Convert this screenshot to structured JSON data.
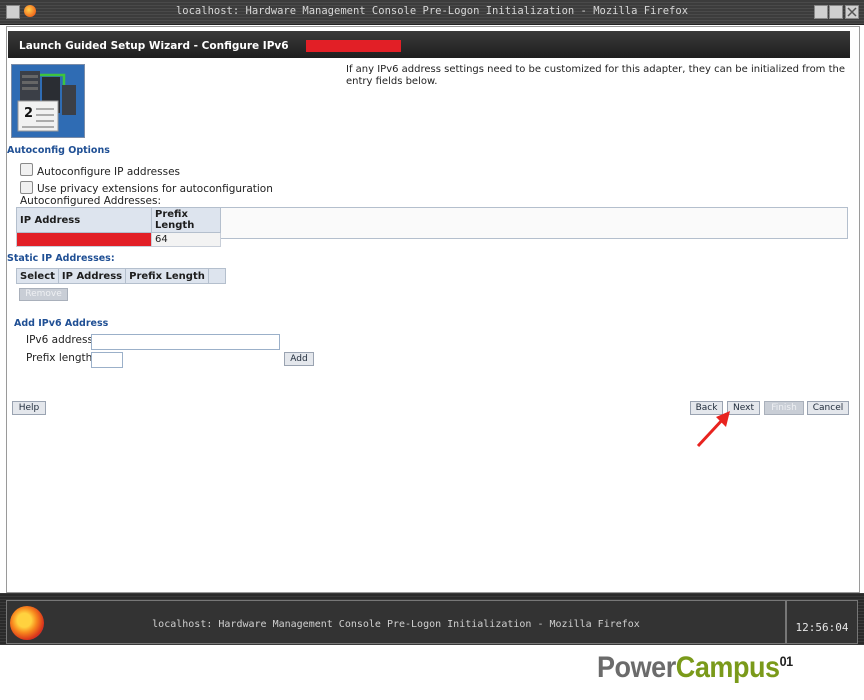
{
  "window": {
    "title": "localhost: Hardware Management Console Pre-Logon Initialization - Mozilla Firefox"
  },
  "header": {
    "title": "Launch Guided Setup Wizard - Configure IPv6"
  },
  "intro_text": "If any IPv6 address settings need to be customized for this adapter, they can be initialized from the entry fields below.",
  "wizard_icon": {
    "step": "2"
  },
  "autoconfig": {
    "heading": "Autoconfig Options",
    "option1": "Autoconfigure IP addresses",
    "option1_checked": false,
    "option2": "Use privacy extensions for autoconfiguration",
    "option2_checked": false,
    "addresses_label": "Autoconfigured Addresses:",
    "columns": [
      "IP Address",
      "Prefix Length"
    ],
    "rows": [
      {
        "ip": "",
        "prefix": "64"
      }
    ]
  },
  "static": {
    "heading": "Static IP Addresses:",
    "columns": [
      "Select",
      "IP Address",
      "Prefix Length"
    ],
    "remove_label": "Remove"
  },
  "add": {
    "heading": "Add IPv6 Address",
    "ipv6_label": "IPv6 address:",
    "ipv6_value": "",
    "prefix_label": "Prefix length:",
    "prefix_value": "",
    "add_label": "Add"
  },
  "buttons": {
    "help": "Help",
    "back": "Back",
    "next": "Next",
    "finish": "Finish",
    "cancel": "Cancel"
  },
  "taskbar": {
    "item_title": "localhost: Hardware Management Console Pre-Logon Initialization - Mozilla Firefox",
    "clock": "12:56:04"
  },
  "watermark": {
    "part1": "Power",
    "part2": "Campus",
    "suffix": "01",
    "color1": "#6b6b6b",
    "color2": "#7a9a1a"
  },
  "colors": {
    "redaction": "#e21f26",
    "section_heading": "#1f4f94",
    "annotation_arrow": "#e8231f"
  }
}
